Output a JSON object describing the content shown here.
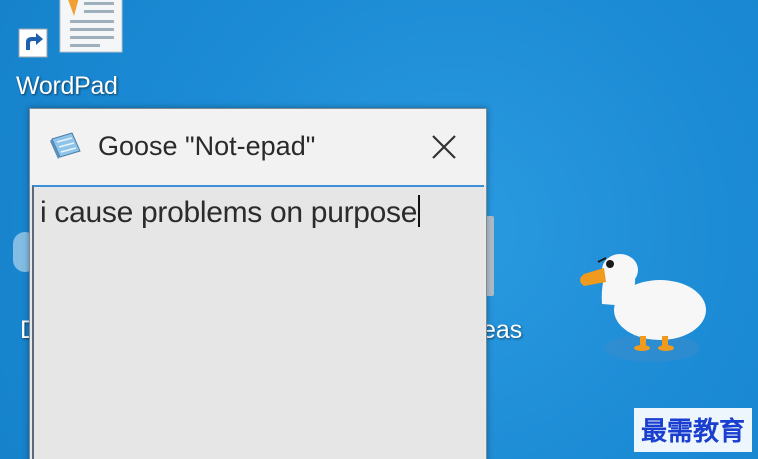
{
  "desktop": {
    "background_color": "#1e8fd8",
    "icons": [
      {
        "label": "WordPad",
        "icon": "wordpad-document-icon",
        "shortcut": true
      }
    ],
    "partial_labels": {
      "left": "D",
      "right": "eas"
    }
  },
  "window": {
    "title": "Goose \"Not-epad\"",
    "title_icon": "notepad-icon",
    "close_icon": "close-icon",
    "editor_text": "i cause problems on purpose",
    "accent_color": "#3a8fd6"
  },
  "goose": {
    "icon": "goose-icon"
  },
  "watermark": {
    "text": "最需教育",
    "color": "#1a3fd0"
  }
}
